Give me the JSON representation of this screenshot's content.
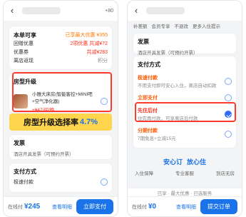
{
  "left": {
    "status_small": "+80",
    "order_section_title": "本单可享",
    "promo_text": "已享最大优惠 ¥355",
    "reward_label": "回赠优惠",
    "reward_value": "2项优惠 共减¥72",
    "coupon_label": "优惠券",
    "coupon_value": "共减¥283",
    "member_label": "离店返现",
    "member_value": "积分",
    "room_upgrade_title": "房型升级",
    "room_upgrade_name": "小雅大床房(智能客控+MINI吧+空气净化器)",
    "room_upgrade_extra": "+¥47/间/晚",
    "banner_text": "房型升级选择率",
    "banner_pct": "4.7%",
    "invoice_title": "发票",
    "invoice_desc": "酒店开具发票（可预约开票）",
    "payment_title": "支付方式",
    "payment_option": "极速付款",
    "bottom_price_tag": "在线付",
    "bottom_price": "¥245",
    "bottom_link": "查看明细",
    "bottom_button": "立即支付"
  },
  "right": {
    "top_tabs": [
      "补差额",
      "会员专享",
      "不退改",
      "更多入住提示"
    ],
    "invoice_title": "发票",
    "invoice_desc": "酒店开具发票（可预约开票）",
    "payment_title": "支付方式",
    "option1_name": "极速付款",
    "option1_desc": "不用支付即可安心入住，离店自动扣款",
    "option2_name": "立即支付",
    "option3_name": "先住后付",
    "option3_desc": "住完再付款，可享离店后付款",
    "option4_name": "分期付款",
    "option4_desc": "7期免息+立减15元",
    "brand_left": "安心订",
    "brand_right": "放心住",
    "features": [
      "入住保障",
      "专业客服",
      "到店无房"
    ],
    "notice_text": "已享 · 最大优惠 · 已选服务",
    "bottom_price_tag": "在线付",
    "bottom_price": "¥0",
    "bottom_link": "查看明细",
    "bottom_button": "提交订单"
  }
}
